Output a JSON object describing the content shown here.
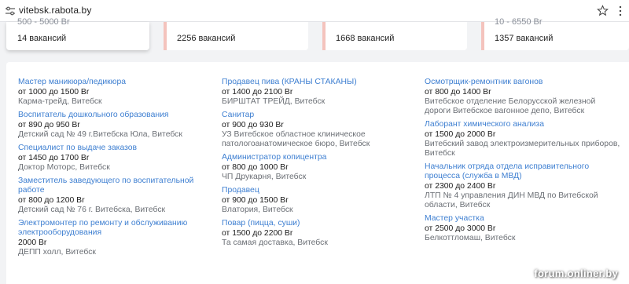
{
  "browser": {
    "url": "vitebsk.rabota.by",
    "icons": {
      "site_info": "tune-icon",
      "bookmark": "star-icon",
      "menu": "kebab-menu-icon"
    }
  },
  "cards": [
    {
      "salary": "500 - 5000 Br",
      "count": "14 вакансий"
    },
    {
      "salary": "",
      "count": "2256 вакансий"
    },
    {
      "salary": "",
      "count": "1668 вакансий"
    },
    {
      "salary": "10 - 6550 Br",
      "count": "1357 вакансий"
    }
  ],
  "columns": [
    [
      {
        "title": "Мастер маникюра/педикюра",
        "salary": "от 1000 до 1500 Br",
        "company": "Карма-трейд, Витебск"
      },
      {
        "title": "Воспитатель дошкольного образования",
        "salary": "от 890 до 950 Br",
        "company": "Детский сад № 49 г.Витебска Юла, Витебск"
      },
      {
        "title": "Специалист по выдаче заказов",
        "salary": "от 1450 до 1700 Br",
        "company": "Доктор Моторс, Витебск"
      },
      {
        "title": "Заместитель заведующего по воспитательной работе",
        "salary": "от 800 до 1200 Br",
        "company": "Детский сад № 76 г. Витебска, Витебск"
      },
      {
        "title": "Электромонтер по ремонту и обслуживанию электрооборудования",
        "salary": "2000 Br",
        "company": "ДЕПП холл, Витебск"
      }
    ],
    [
      {
        "title": "Продавец пива (КРАНЫ СТАКАНЫ)",
        "salary": "от 1400 до 2100 Br",
        "company": "БИРШТАТ ТРЕЙД, Витебск"
      },
      {
        "title": "Санитар",
        "salary": "от 900 до 930 Br",
        "company": "УЗ Витебское областное клиническое патологоанатомическое бюро, Витебск"
      },
      {
        "title": "Администратор копицентра",
        "salary": "от 800 до 1000 Br",
        "company": "ЧП Друкарня, Витебск"
      },
      {
        "title": "Продавец",
        "salary": "от 900 до 1500 Br",
        "company": "Влатория, Витебск"
      },
      {
        "title": "Повар (пицца, суши)",
        "salary": "от 1500 до 2200 Br",
        "company": "Та самая доставка, Витебск"
      }
    ],
    [
      {
        "title": "Осмотрщик-ремонтник вагонов",
        "salary": "от 800 до 1400 Br",
        "company": "Витебское отделение Белорусской железной дороги Витебское вагонное депо, Витебск"
      },
      {
        "title": "Лаборант химического анализа",
        "salary": "от 1500 до 2000 Br",
        "company": "Витебский завод электроизмерительных приборов, Витебск"
      },
      {
        "title": "Начальник отряда отдела исправительного процесса (служба в МВД)",
        "salary": "от 2300 до 2400 Br",
        "company": "ЛТП № 4 управления ДИН МВД по Витебской области, Витебск"
      },
      {
        "title": "Мастер участка",
        "salary": "от 2500 до 3000 Br",
        "company": "Белкоттломаш, Витебск"
      }
    ]
  ],
  "watermark": "forum.onliner.by",
  "colors": {
    "link": "#3e7fd1",
    "accent_bar": "#f4c3bd",
    "background": "#f2f3f5"
  }
}
